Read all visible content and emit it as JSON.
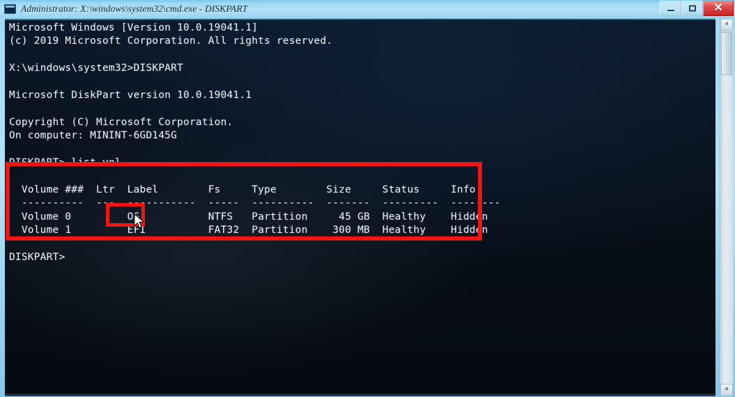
{
  "window": {
    "title": "Administrator: X:\\windows\\system32\\cmd.exe  -  DISKPART",
    "icon": "console-icon",
    "controls": {
      "minimize_label": "–",
      "maximize_label": "□",
      "close_label": "✕"
    }
  },
  "scrollbar": {
    "up_arrow": "ⱏ",
    "down_arrow": "ⱞ"
  },
  "colors": {
    "annotation_red": "#f01616",
    "console_background": "#0a1420",
    "console_text": "#e8eef4",
    "titlebar_blue": "#9ed8f2",
    "close_button_red": "#c92525"
  },
  "console": {
    "lines": [
      "Microsoft Windows [Version 10.0.19041.1]",
      "(c) 2019 Microsoft Corporation. All rights reserved.",
      "",
      "X:\\windows\\system32>DISKPART",
      "",
      "Microsoft DiskPart version 10.0.19041.1",
      "",
      "Copyright (C) Microsoft Corporation.",
      "On computer: MININT-6GD145G",
      "",
      "DISKPART> list vol",
      "",
      "  Volume ###  Ltr  Label        Fs     Type        Size     Status     Info",
      "  ----------  ---  -----------  -----  ----------  -------  ---------  --------",
      "  Volume 0         OS           NTFS   Partition     45 GB  Healthy    Hidden",
      "  Volume 1         EFI          FAT32  Partition    300 MB  Healthy    Hidden",
      "",
      "DISKPART>"
    ],
    "full_text": "Microsoft Windows [Version 10.0.19041.1]\n(c) 2019 Microsoft Corporation. All rights reserved.\n\nX:\\windows\\system32>DISKPART\n\nMicrosoft DiskPart version 10.0.19041.1\n\nCopyright (C) Microsoft Corporation.\nOn computer: MININT-6GD145G\n\nDISKPART> list vol\n\n  Volume ###  Ltr  Label        Fs     Type        Size     Status     Info\n  ----------  ---  -----------  -----  ----------  -------  ---------  --------\n  Volume 0         OS           NTFS   Partition     45 GB  Healthy    Hidden\n  Volume 1         EFI          FAT32  Partition    300 MB  Healthy    Hidden\n\nDISKPART>",
    "prompt_final": "DISKPART>",
    "command_issued": "list vol",
    "os_banner": {
      "product": "Microsoft Windows",
      "version": "[Version 10.0.19041.1]",
      "copyright": "(c) 2019 Microsoft Corporation. All rights reserved."
    },
    "diskpart_banner": {
      "version_line": "Microsoft DiskPart version 10.0.19041.1",
      "copyright_line": "Copyright (C) Microsoft Corporation.",
      "computer_line": "On computer: MININT-6GD145G",
      "computer_name": "MININT-6GD145G"
    }
  },
  "volume_table": {
    "headers": [
      "Volume ###",
      "Ltr",
      "Label",
      "Fs",
      "Type",
      "Size",
      "Status",
      "Info"
    ],
    "rows": [
      {
        "volume": "Volume 0",
        "ltr": "",
        "label": "OS",
        "fs": "NTFS",
        "type": "Partition",
        "size": "45 GB",
        "status": "Healthy",
        "info": "Hidden"
      },
      {
        "volume": "Volume 1",
        "ltr": "",
        "label": "EFI",
        "fs": "FAT32",
        "type": "Partition",
        "size": "300 MB",
        "status": "Healthy",
        "info": "Hidden"
      }
    ]
  },
  "annotations": {
    "table_highlight": "red rectangle around volume listing",
    "efi_highlight": "red rectangle around EFI label",
    "cursor": "mouse-pointer over EFI label"
  }
}
